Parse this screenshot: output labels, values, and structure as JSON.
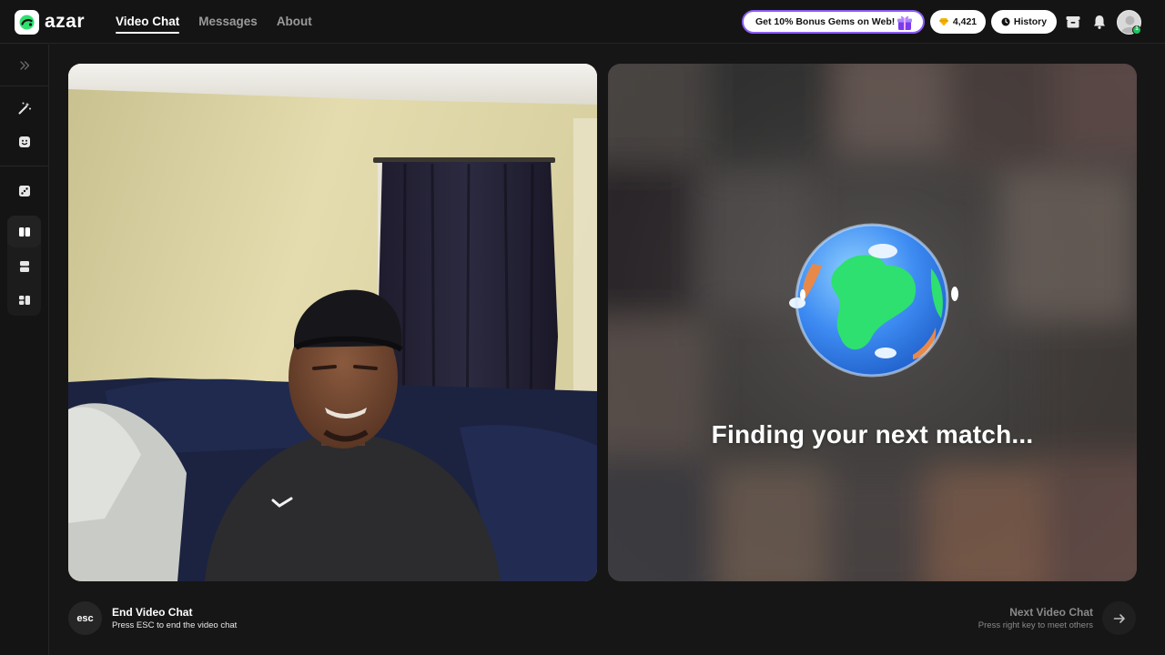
{
  "brand": {
    "name": "azar",
    "accent": "#2ee06f"
  },
  "nav": [
    {
      "label": "Video Chat",
      "active": true
    },
    {
      "label": "Messages",
      "active": false
    },
    {
      "label": "About",
      "active": false
    }
  ],
  "header": {
    "promo_label": "Get 10% Bonus Gems on Web!",
    "gems_count": "4,421",
    "history_label": "History",
    "promo_border_color": "#8b5cf6",
    "online_badge": "1"
  },
  "sidebar": {
    "items": [
      {
        "icon": "chevrons-right-icon"
      },
      {
        "icon": "magic-wand-icon"
      },
      {
        "icon": "face-filter-icon"
      },
      {
        "icon": "dice-icon"
      },
      {
        "icon": "layout-side-by-side-icon",
        "active": true
      },
      {
        "icon": "layout-stacked-icon"
      },
      {
        "icon": "layout-grid-icon"
      }
    ]
  },
  "match": {
    "status_text": "Finding your next match..."
  },
  "footer": {
    "esc_label": "esc",
    "end_title": "End Video Chat",
    "end_subtitle": "Press ESC to end the video chat",
    "next_title": "Next Video Chat",
    "next_subtitle": "Press right key to meet others"
  }
}
